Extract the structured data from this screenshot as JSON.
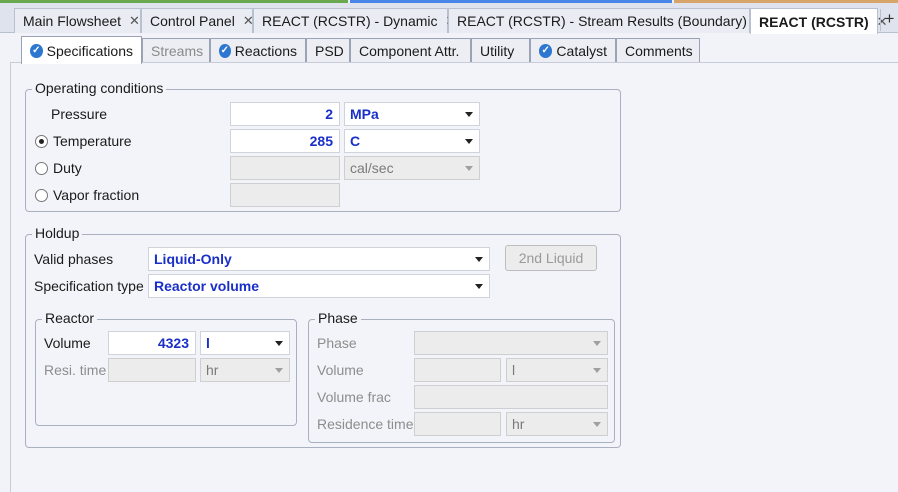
{
  "doc_tabs": [
    {
      "label": "Main Flowsheet"
    },
    {
      "label": "Control Panel"
    },
    {
      "label": "REACT (RCSTR) - Dynamic"
    },
    {
      "label": "REACT (RCSTR) - Stream Results (Boundary)"
    },
    {
      "label": "REACT (RCSTR)"
    }
  ],
  "form_tabs": [
    {
      "label": "Specifications"
    },
    {
      "label": "Streams"
    },
    {
      "label": "Reactions"
    },
    {
      "label": "PSD"
    },
    {
      "label": "Component Attr."
    },
    {
      "label": "Utility"
    },
    {
      "label": "Catalyst"
    },
    {
      "label": "Comments"
    }
  ],
  "operating": {
    "title": "Operating conditions",
    "pressure": {
      "label": "Pressure",
      "value": "2",
      "unit": "MPa"
    },
    "temperature": {
      "label": "Temperature",
      "value": "285",
      "unit": "C"
    },
    "duty": {
      "label": "Duty",
      "value": "",
      "unit": "cal/sec"
    },
    "vapor_fraction": {
      "label": "Vapor fraction",
      "value": ""
    }
  },
  "holdup": {
    "title": "Holdup",
    "valid_phases": {
      "label": "Valid phases",
      "value": "Liquid-Only"
    },
    "spec_type": {
      "label": "Specification type",
      "value": "Reactor volume"
    },
    "second_liquid": "2nd Liquid",
    "reactor": {
      "title": "Reactor",
      "volume": {
        "label": "Volume",
        "value": "4323",
        "unit": "l"
      },
      "resi_time": {
        "label": "Resi. time",
        "value": "",
        "unit": "hr"
      }
    },
    "phase": {
      "title": "Phase",
      "phase": {
        "label": "Phase",
        "value": ""
      },
      "volume": {
        "label": "Volume",
        "value": "",
        "unit": "l"
      },
      "volume_frac": {
        "label": "Volume frac",
        "value": ""
      },
      "residence_time": {
        "label": "Residence time",
        "value": "",
        "unit": "hr"
      }
    }
  }
}
